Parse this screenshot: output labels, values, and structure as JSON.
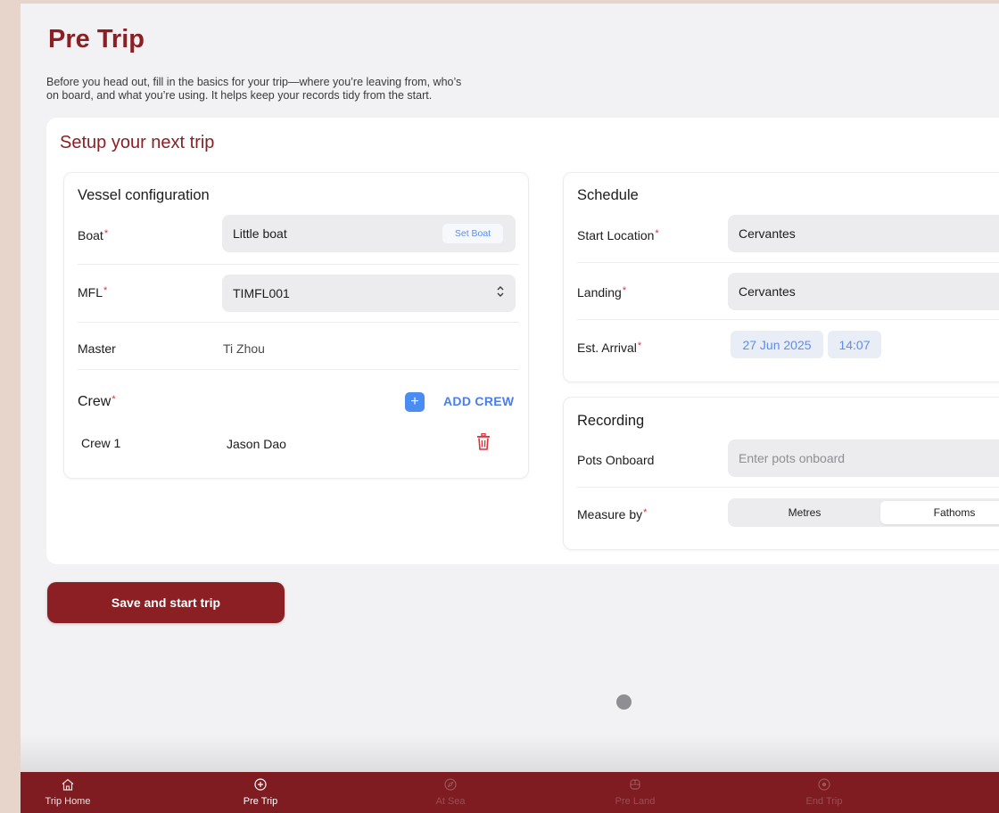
{
  "page": {
    "title": "Pre Trip",
    "description_line1": "Before you head out, fill in the basics for your trip—where you’re leaving from, who’s",
    "description_line2": "on board, and what you’re using. It helps keep your records tidy from the start."
  },
  "card": {
    "heading": "Setup your next trip"
  },
  "vessel": {
    "title": "Vessel configuration",
    "boat_label": "Boat",
    "boat_value": "Little boat",
    "set_boat_label": "Set Boat",
    "mfl_label": "MFL",
    "mfl_value": "TIMFL001",
    "master_label": "Master",
    "master_value": "Ti Zhou",
    "crew_label": "Crew",
    "add_crew_label": "ADD CREW",
    "crew": [
      {
        "label": "Crew 1",
        "name": "Jason Dao"
      }
    ]
  },
  "schedule": {
    "title": "Schedule",
    "start_location_label": "Start Location",
    "start_location_value": "Cervantes",
    "landing_label": "Landing",
    "landing_value": "Cervantes",
    "arrival_label": "Est. Arrival",
    "arrival_date": "27 Jun 2025",
    "arrival_time": "14:07"
  },
  "recording": {
    "title": "Recording",
    "pots_label": "Pots Onboard",
    "pots_placeholder": "Enter pots onboard",
    "measure_label": "Measure by",
    "measure_options": [
      "Metres",
      "Fathoms"
    ],
    "measure_selected": "Fathoms"
  },
  "actions": {
    "save_label": "Save and start trip"
  },
  "tabbar": {
    "tabs": [
      {
        "label": "Trip Home",
        "icon": "home-icon"
      },
      {
        "label": "Pre Trip",
        "icon": "plus-circle-icon",
        "active": true
      },
      {
        "label": "At Sea",
        "icon": "compass-icon",
        "disabled": true
      },
      {
        "label": "Pre Land",
        "icon": "ship-icon",
        "disabled": true
      },
      {
        "label": "End Trip",
        "icon": "stop-icon",
        "disabled": true
      }
    ]
  },
  "colors": {
    "brand": "#8b1f24",
    "tabbar": "#7e1c21",
    "accent_blue": "#4a8cf2",
    "required": "#d9323a",
    "delete": "#d9323a"
  }
}
